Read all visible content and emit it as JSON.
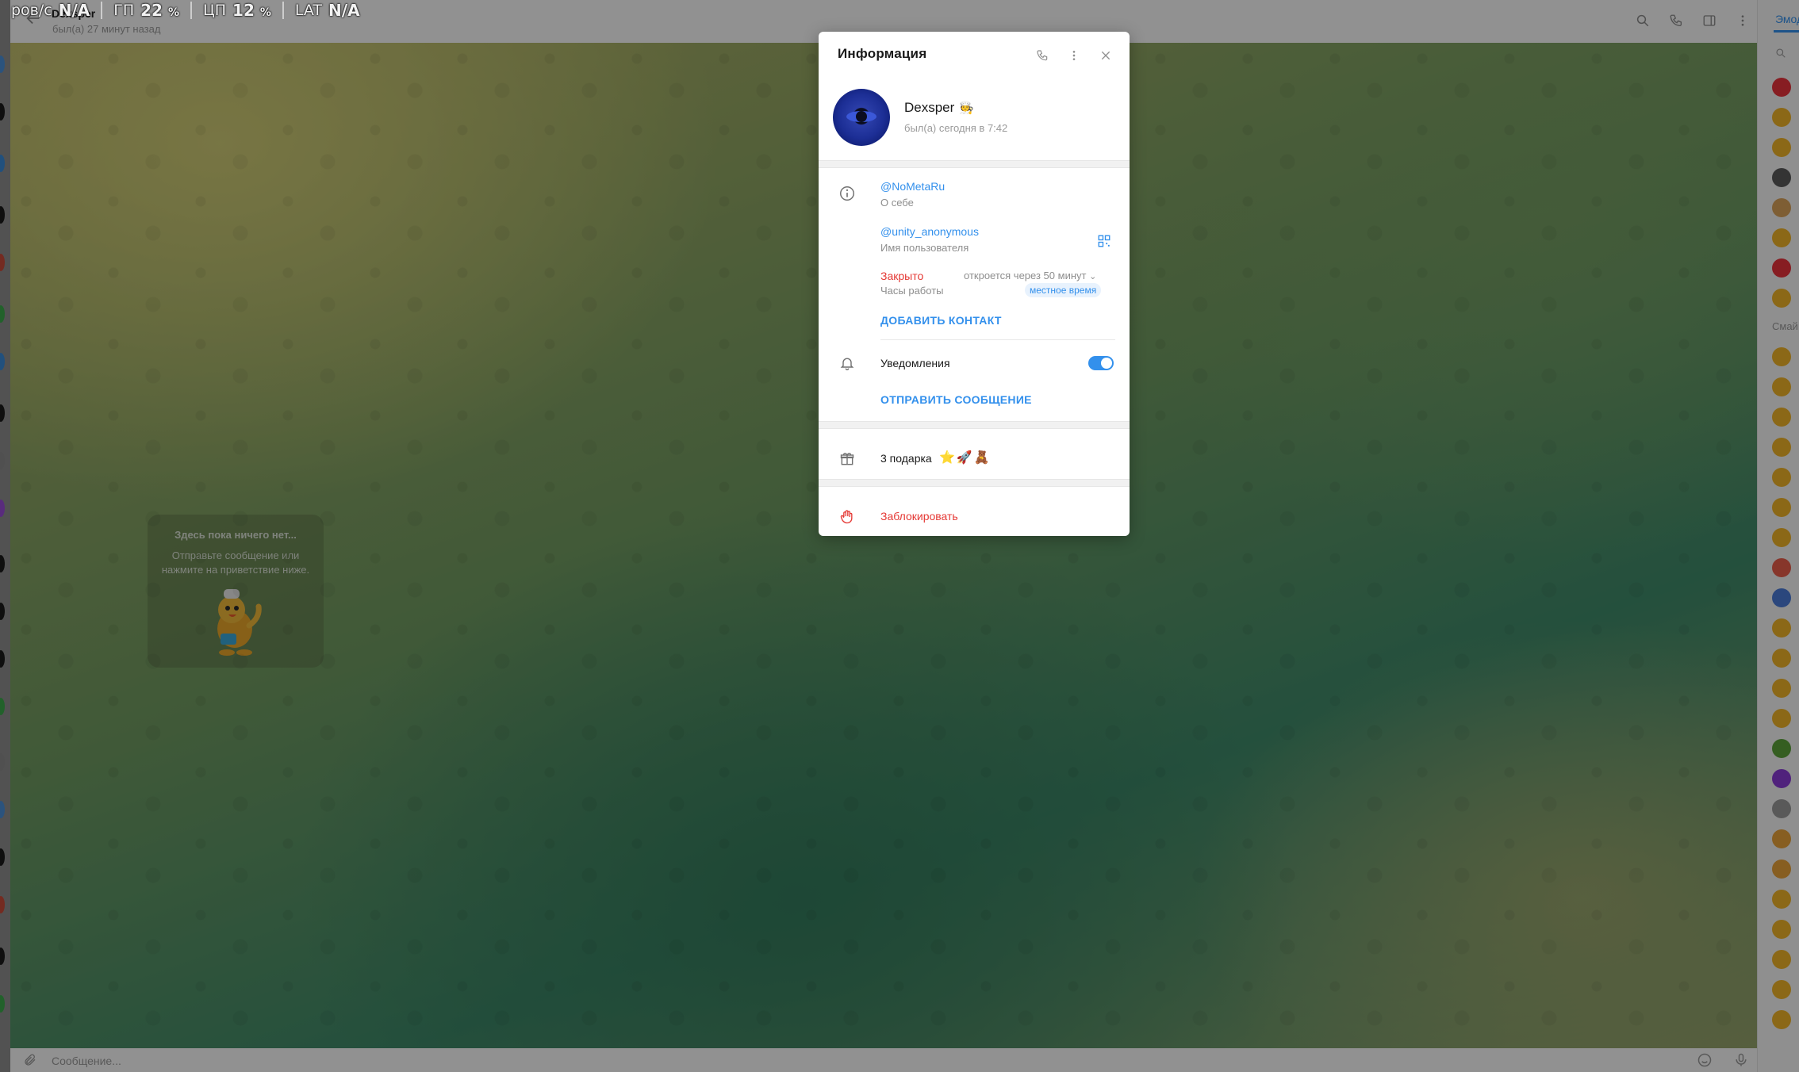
{
  "osd": {
    "seg1_key": "ров/с",
    "seg1_val": "N/A",
    "seg2_key": "ГП",
    "seg2_val": "22",
    "seg2_unit": "%",
    "seg3_key": "ЦП",
    "seg3_val": "12",
    "seg3_unit": "%",
    "seg4_key": "LAT",
    "seg4_val": "N/A"
  },
  "chat_header": {
    "name": "Dexsper",
    "status": "был(а) 27 минут назад"
  },
  "empty_chat": {
    "title": "Здесь пока ничего нет...",
    "text": "Отправьте сообщение или нажмите на приветствие ниже."
  },
  "input": {
    "placeholder": "Сообщение..."
  },
  "emoji_panel": {
    "tab_label": "Эмод",
    "section_label": "Смай",
    "emoji_colors": [
      "#e8323c",
      "#f0b429",
      "#f0b429",
      "#5a5a5a",
      "#d9a25a",
      "#f0b429",
      "#e8323c",
      "#f0b429",
      "#f0b429",
      "#f0b429",
      "#f0b429",
      "#f0b429",
      "#f0b429",
      "#f0b429",
      "#f0b429",
      "#e85d4a",
      "#4a7bd8",
      "#f0b429",
      "#f0b429",
      "#f0b429",
      "#f0b429",
      "#5ca33a",
      "#8b3bd6",
      "#9a9a9a",
      "#e8a23a",
      "#e8a23a",
      "#f0b429",
      "#f0b429",
      "#f0b429",
      "#f0b429",
      "#f0b429"
    ]
  },
  "dialog": {
    "title": "Информация",
    "profile": {
      "name": "Dexsper",
      "name_badge": "🧑‍🍳",
      "status": "был(а) сегодня в 7:42"
    },
    "bio": {
      "value": "@NoMetaRu",
      "label": "О себе"
    },
    "username": {
      "value": "@unity_anonymous",
      "label": "Имя пользователя"
    },
    "business_hours": {
      "state": "Закрыто",
      "opens": "откроется через 50 минут",
      "label": "Часы работы",
      "local_time": "местное время"
    },
    "add_contact": "ДОБАВИТЬ КОНТАКТ",
    "notifications": {
      "label": "Уведомления",
      "enabled": true
    },
    "send_message": "ОТПРАВИТЬ СООБЩЕНИЕ",
    "gifts": {
      "label": "3 подарка",
      "icons": [
        "⭐",
        "🚀",
        "🧸"
      ]
    },
    "block": "Заблокировать"
  },
  "colors": {
    "accent": "#3390ec",
    "danger": "#e53935"
  }
}
